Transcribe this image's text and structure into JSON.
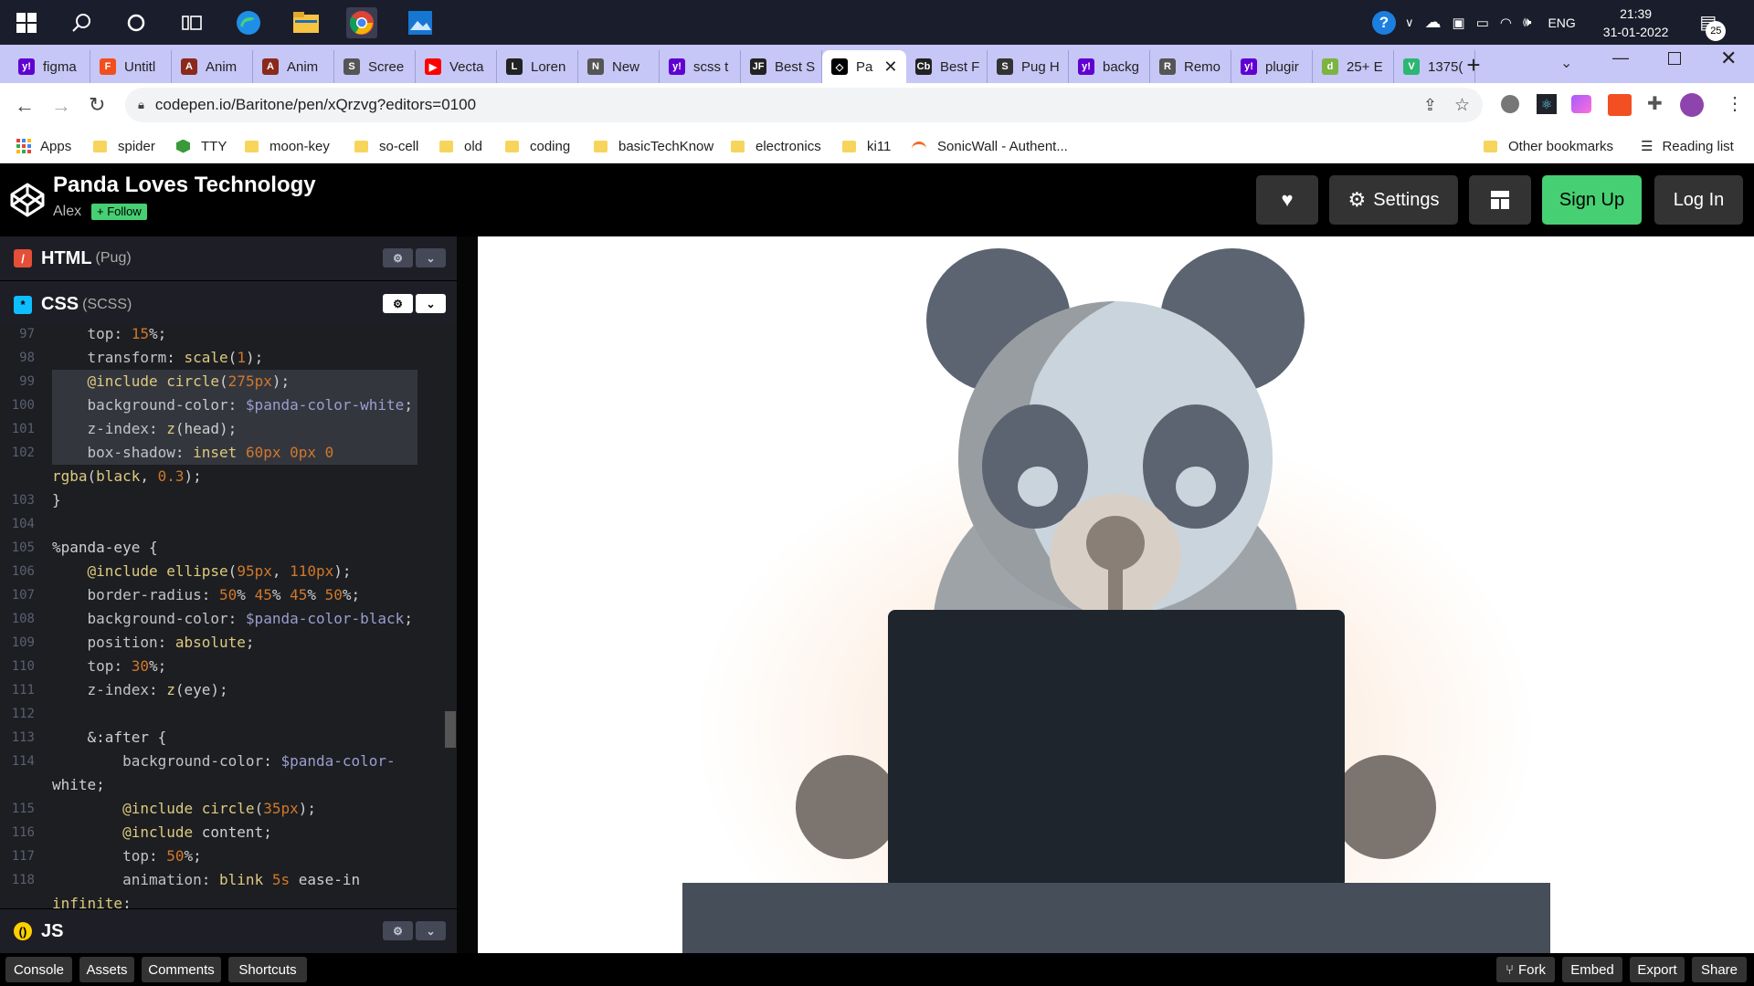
{
  "taskbar": {
    "tray": {
      "language": "ENG",
      "time": "21:39",
      "date": "31-01-2022",
      "notifications": "25"
    }
  },
  "tabs": [
    {
      "label": "figma",
      "fav": "y!",
      "color": "#6001d2"
    },
    {
      "label": "Untitl",
      "fav": "F",
      "color": "#f24e1e"
    },
    {
      "label": "Anim",
      "fav": "A",
      "color": "#8a2a1c"
    },
    {
      "label": "Anim",
      "fav": "A",
      "color": "#8a2a1c"
    },
    {
      "label": "Scree",
      "fav": "S",
      "color": "#555"
    },
    {
      "label": "Vecta",
      "fav": "▶",
      "color": "#ff0000"
    },
    {
      "label": "Loren",
      "fav": "L",
      "color": "#222"
    },
    {
      "label": "New",
      "fav": "N",
      "color": "#555"
    },
    {
      "label": "scss t",
      "fav": "y!",
      "color": "#6001d2"
    },
    {
      "label": "Best S",
      "fav": "JF",
      "color": "#222"
    },
    {
      "label": "Pa",
      "fav": "◇",
      "color": "#000",
      "active": true
    },
    {
      "label": "Best F",
      "fav": "Cb",
      "color": "#222"
    },
    {
      "label": "Pug H",
      "fav": "S",
      "color": "#333"
    },
    {
      "label": "backg",
      "fav": "y!",
      "color": "#6001d2"
    },
    {
      "label": "Remo",
      "fav": "R",
      "color": "#555"
    },
    {
      "label": "plugir",
      "fav": "y!",
      "color": "#6001d2"
    },
    {
      "label": "25+ E",
      "fav": "d",
      "color": "#7cb342"
    },
    {
      "label": "1375(",
      "fav": "V",
      "color": "#2bb673"
    }
  ],
  "address": {
    "url": "codepen.io/Baritone/pen/xQrzvg?editors=0100"
  },
  "bookmarks": {
    "apps": "Apps",
    "items": [
      "spider",
      "TTY",
      "moon-key",
      "so-cell",
      "old",
      "coding",
      "basicTechKnow",
      "electronics",
      "ki11",
      "SonicWall - Authent..."
    ],
    "other": "Other bookmarks",
    "reading": "Reading list"
  },
  "header": {
    "title": "Panda Loves Technology",
    "author": "Alex",
    "follow": "+ Follow",
    "settings": "Settings",
    "signup": "Sign Up",
    "login": "Log In"
  },
  "panels": {
    "html": {
      "name": "HTML",
      "sub": "(Pug)"
    },
    "css": {
      "name": "CSS",
      "sub": "(SCSS)"
    },
    "js": {
      "name": "JS",
      "sub": ""
    }
  },
  "code_lines": [
    {
      "n": "97",
      "t": "    top: 15%;"
    },
    {
      "n": "98",
      "t": "    transform: scale(1);"
    },
    {
      "n": "99",
      "t": "    @include circle(275px);",
      "sel": true
    },
    {
      "n": "100",
      "t": "    background-color: $panda-color-white;",
      "sel": true
    },
    {
      "n": "101",
      "t": "    z-index: z(head);",
      "sel": true
    },
    {
      "n": "102",
      "t": "    box-shadow: inset 60px 0px 0 ",
      "sel": true
    },
    {
      "n": "",
      "t": "rgba(black, 0.3);"
    },
    {
      "n": "103",
      "t": "}"
    },
    {
      "n": "104",
      "t": ""
    },
    {
      "n": "105",
      "t": "%panda-eye {"
    },
    {
      "n": "106",
      "t": "    @include ellipse(95px, 110px);"
    },
    {
      "n": "107",
      "t": "    border-radius: 50% 45% 45% 50%;"
    },
    {
      "n": "108",
      "t": "    background-color: $panda-color-black;"
    },
    {
      "n": "109",
      "t": "    position: absolute;"
    },
    {
      "n": "110",
      "t": "    top: 30%;"
    },
    {
      "n": "111",
      "t": "    z-index: z(eye);"
    },
    {
      "n": "112",
      "t": ""
    },
    {
      "n": "113",
      "t": "    &:after {"
    },
    {
      "n": "114",
      "t": "        background-color: $panda-color-"
    },
    {
      "n": "",
      "t": "white;"
    },
    {
      "n": "115",
      "t": "        @include circle(35px);"
    },
    {
      "n": "116",
      "t": "        @include content;"
    },
    {
      "n": "117",
      "t": "        top: 50%;"
    },
    {
      "n": "118",
      "t": "        animation: blink 5s ease-in"
    },
    {
      "n": "",
      "t": "infinite;"
    }
  ],
  "footer": {
    "console": "Console",
    "assets": "Assets",
    "comments": "Comments",
    "shortcuts": "Shortcuts",
    "fork": "Fork",
    "embed": "Embed",
    "export": "Export",
    "share": "Share"
  }
}
